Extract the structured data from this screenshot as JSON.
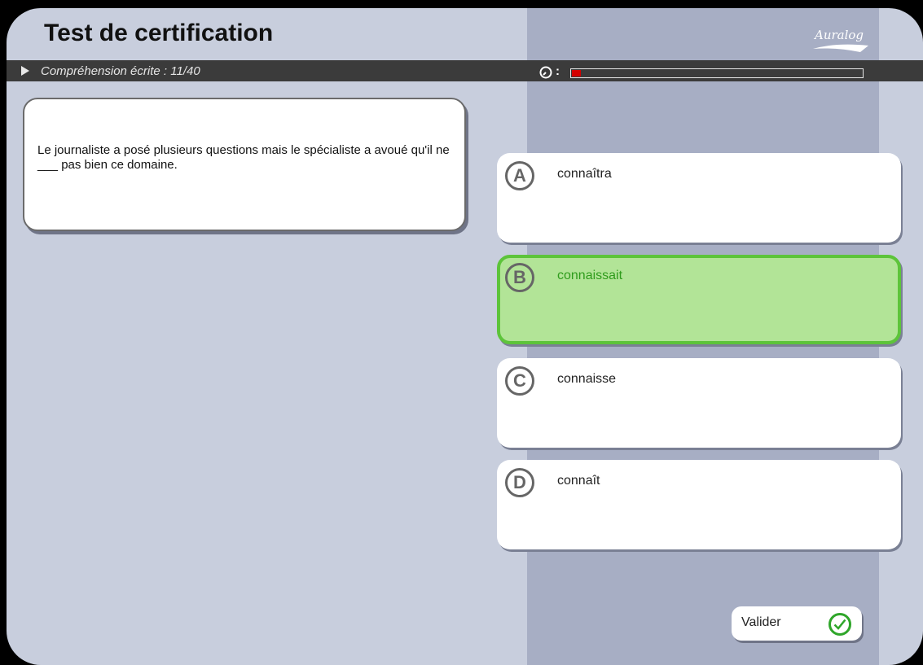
{
  "header": {
    "title": "Test de certification",
    "logo_text": "Auralog"
  },
  "section_bar": {
    "label": "Compréhension écrite : 11/40",
    "timer_separator": ":",
    "timer_progress": 0.03
  },
  "question": {
    "text": "Le journaliste a posé plusieurs questions mais le spécialiste a avoué qu'il ne ___ pas bien ce domaine."
  },
  "choices": [
    {
      "letter": "A",
      "text": "connaîtra",
      "selected": false
    },
    {
      "letter": "B",
      "text": "connaissait",
      "selected": true
    },
    {
      "letter": "C",
      "text": "connaisse",
      "selected": false
    },
    {
      "letter": "D",
      "text": "connaît",
      "selected": false
    }
  ],
  "actions": {
    "validate_label": "Valider"
  },
  "colors": {
    "selected_fill": "#b2e497",
    "selected_border": "#5dc43a",
    "timer_fill": "#d40000",
    "check_green": "#2fa62a"
  },
  "icons": {
    "section_arrow": "play-arrow-icon",
    "timer": "clock-icon",
    "validate": "checkmark-circle-icon"
  }
}
